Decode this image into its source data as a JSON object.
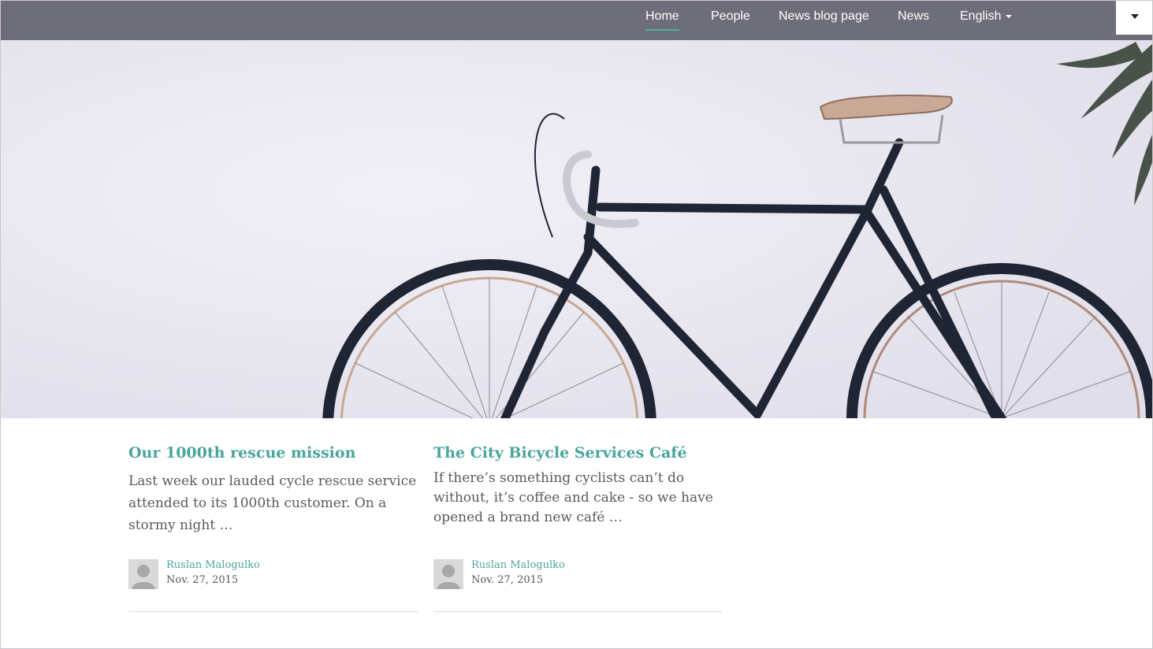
{
  "nav": {
    "items": [
      {
        "label": "Home",
        "active": true
      },
      {
        "label": "People",
        "active": false
      },
      {
        "label": "News blog page",
        "active": false
      },
      {
        "label": "News",
        "active": false
      }
    ],
    "language": "English"
  },
  "colors": {
    "navbar": "#6e6e7a",
    "accent": "#4aa59b",
    "hero_background": "#e7e6ee"
  },
  "hero": {
    "image": "bicycle-leaning-on-white-wall"
  },
  "posts": [
    {
      "title": "Our 1000th rescue mission",
      "lead": "Last week our lauded cycle rescue service attended to its 1000th customer. On a stormy night …",
      "author": "Ruslan Malogulko",
      "date": "Nov. 27, 2015"
    },
    {
      "title": "The City Bicycle Services Café",
      "lead": "If there’s something cyclists can’t do without, it’s coffee and cake - so we have opened a brand new café …",
      "author": "Ruslan Malogulko",
      "date": "Nov. 27, 2015"
    }
  ]
}
